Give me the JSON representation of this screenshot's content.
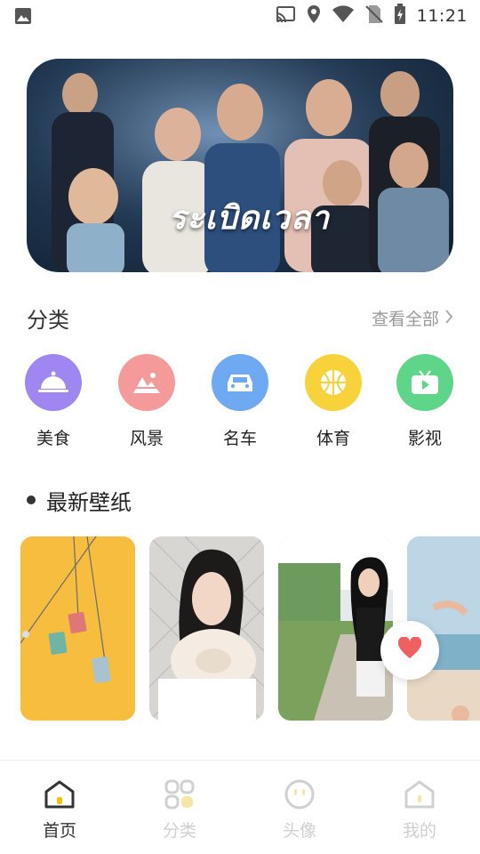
{
  "status_bar": {
    "time": "11:21",
    "icons": [
      "image-icon",
      "cast-icon",
      "location-icon",
      "wifi-icon",
      "no-sim-icon",
      "battery-charging-icon"
    ]
  },
  "banner": {
    "title_text": "ระเบิดเวลา",
    "dots": 2,
    "active_dot": 0
  },
  "categories": {
    "title": "分类",
    "see_all": "查看全部",
    "items": [
      {
        "label": "美食",
        "icon": "food-cloche-icon",
        "color": "#9f86f0"
      },
      {
        "label": "风景",
        "icon": "landscape-icon",
        "color": "#f59a9a"
      },
      {
        "label": "名车",
        "icon": "car-icon",
        "color": "#6ea9f2"
      },
      {
        "label": "体育",
        "icon": "basketball-icon",
        "color": "#f7d23b"
      },
      {
        "label": "影视",
        "icon": "tv-play-icon",
        "color": "#5fd58a"
      }
    ]
  },
  "latest": {
    "title": "最新壁纸"
  },
  "bottom_nav": {
    "items": [
      {
        "label": "首页",
        "icon": "home-icon",
        "active": true
      },
      {
        "label": "分类",
        "icon": "category-grid-icon",
        "active": false
      },
      {
        "label": "头像",
        "icon": "avatar-face-icon",
        "active": false
      },
      {
        "label": "我的",
        "icon": "profile-house-icon",
        "active": false
      }
    ]
  },
  "colors": {
    "accent": "#f5c400",
    "heart": "#f06060"
  }
}
